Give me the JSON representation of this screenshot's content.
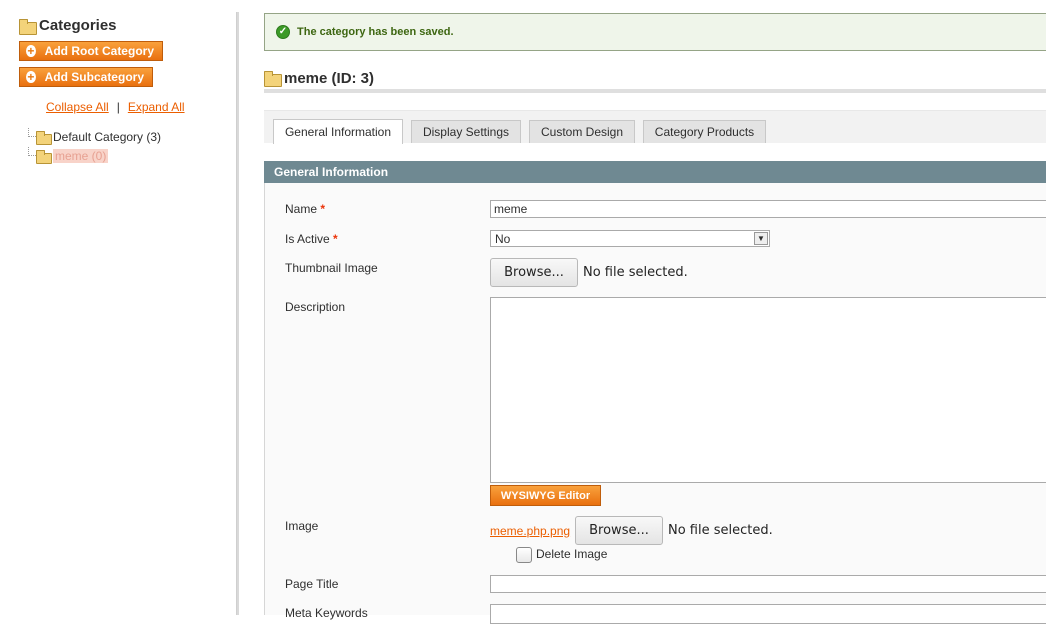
{
  "sidebar": {
    "title": "Categories",
    "add_root_label": "Add Root Category",
    "add_sub_label": "Add Subcategory",
    "collapse_all": "Collapse All",
    "separator": "|",
    "expand_all": "Expand All",
    "tree": [
      {
        "label": "Default Category (3)",
        "selected": false
      },
      {
        "label": "meme (0)",
        "selected": true
      }
    ]
  },
  "message": {
    "text": "The category has been saved.",
    "type": "success"
  },
  "page": {
    "title": "meme (ID: 3)"
  },
  "tabs": [
    {
      "label": "General Information",
      "active": true
    },
    {
      "label": "Display Settings",
      "active": false
    },
    {
      "label": "Custom Design",
      "active": false
    },
    {
      "label": "Category Products",
      "active": false
    }
  ],
  "section": {
    "title": "General Information"
  },
  "form": {
    "name": {
      "label": "Name",
      "required": "*",
      "value": "meme"
    },
    "is_active": {
      "label": "Is Active",
      "required": "*",
      "value": "No"
    },
    "thumbnail": {
      "label": "Thumbnail Image",
      "browse": "Browse...",
      "status": "No file selected."
    },
    "description": {
      "label": "Description",
      "value": "",
      "wysiwyg": "WYSIWYG Editor"
    },
    "image": {
      "label": "Image",
      "current_file": "meme.php.png",
      "browse": "Browse...",
      "status": "No file selected.",
      "delete_label": "Delete Image"
    },
    "page_title": {
      "label": "Page Title",
      "value": ""
    },
    "meta_keywords": {
      "label": "Meta Keywords"
    }
  },
  "colors": {
    "accent": "#eb5e00",
    "button": "#f18200",
    "section_header": "#6f8992",
    "success": "#3d6611"
  }
}
